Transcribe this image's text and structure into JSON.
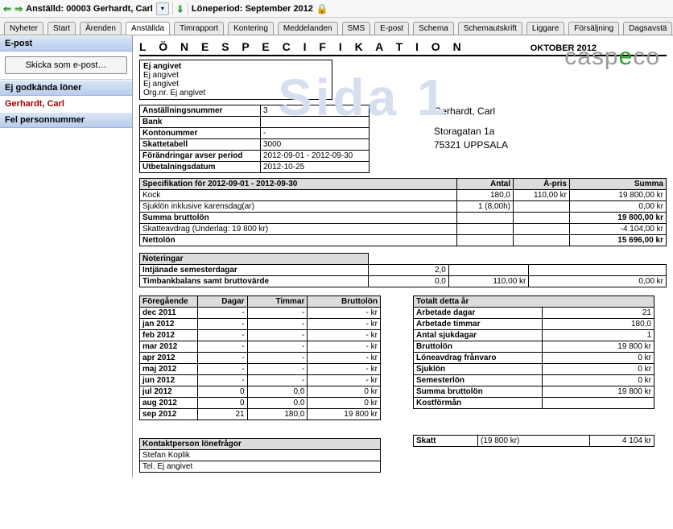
{
  "topbar": {
    "employee_label": "Anställd: 00003 Gerhardt, Carl",
    "period_label": "Löneperiod: September 2012"
  },
  "tabs": [
    "Nyheter",
    "Start",
    "Ärenden",
    "Anställda",
    "Timrapport",
    "Kontering",
    "Meddelanden",
    "SMS",
    "E-post",
    "Schema",
    "Schemautskrift",
    "Liggare",
    "Försäljning",
    "Dagsavstä"
  ],
  "sidebar": {
    "epost_hdr": "E-post",
    "email_btn": "Skicka som e-post…",
    "ej_godk_hdr": "Ej godkända löner",
    "employee_link": "Gerhardt, Carl",
    "fel_pers_hdr": "Fel personnummer"
  },
  "doc": {
    "title": "L Ö N E S P E C I F I K A T I O N",
    "month": "OKTOBER 2012",
    "watermark": "Sida 1",
    "logo": "caspeco",
    "company": {
      "l1": "Ej angivet",
      "l2": "Ej angivet",
      "l3": "Ej angivet",
      "l4": "Org.nr. Ej angivet"
    },
    "emp_info": [
      [
        "Anställningsnummer",
        "3"
      ],
      [
        "Bank",
        ""
      ],
      [
        "Kontonummer",
        "-"
      ],
      [
        "Skattetabell",
        "3000"
      ],
      [
        "Förändringar avser period",
        "2012-09-01 - 2012-09-30"
      ],
      [
        "Utbetalningsdatum",
        "2012-10-25"
      ]
    ],
    "name": "Gerhardt, Carl",
    "addr1": "Storagatan 1a",
    "addr2": "75321 UPPSALA",
    "spec_hdr": "Specifikation för 2012-09-01 - 2012-09-30",
    "spec_cols": [
      "",
      "Antal",
      "À-pris",
      "Summa"
    ],
    "spec_rows": [
      {
        "label": "Kock",
        "antal": "180,0",
        "apris": "110,00 kr",
        "summa": "19 800,00 kr",
        "bold": false
      },
      {
        "label": "Sjuklön inklusive karensdag(ar)",
        "antal": "1 (8,00h)",
        "apris": "",
        "summa": "0,00 kr",
        "bold": false
      },
      {
        "label": "Summa bruttolön",
        "antal": "",
        "apris": "",
        "summa": "19 800,00 kr",
        "bold": true
      },
      {
        "label": "Skatteavdrag (Underlag: 19 800 kr)",
        "antal": "",
        "apris": "",
        "summa": "-4 104,00 kr",
        "bold": false
      },
      {
        "label": "Nettolön",
        "antal": "",
        "apris": "",
        "summa": "15 696,00 kr",
        "bold": true
      }
    ],
    "notes_hdr": "Noteringar",
    "notes_rows": [
      {
        "label": "Intjänade semesterdagar",
        "c2": "2,0",
        "c3": "",
        "c4": ""
      },
      {
        "label": "Timbankbalans samt bruttovärde",
        "c2": "0,0",
        "c3": "110,00 kr",
        "c4": "0,00 kr"
      }
    ],
    "prev_cols": [
      "Föregående",
      "Dagar",
      "Timmar",
      "Bruttolön"
    ],
    "prev_rows": [
      [
        "dec 2011",
        "-",
        "-",
        "- kr"
      ],
      [
        "jan 2012",
        "-",
        "-",
        "- kr"
      ],
      [
        "feb 2012",
        "-",
        "-",
        "- kr"
      ],
      [
        "mar 2012",
        "-",
        "-",
        "- kr"
      ],
      [
        "apr 2012",
        "-",
        "-",
        "- kr"
      ],
      [
        "maj 2012",
        "-",
        "-",
        "- kr"
      ],
      [
        "jun 2012",
        "-",
        "-",
        "- kr"
      ],
      [
        "jul 2012",
        "0",
        "0,0",
        "0 kr"
      ],
      [
        "aug 2012",
        "0",
        "0,0",
        "0 kr"
      ],
      [
        "sep 2012",
        "21",
        "180,0",
        "19 800 kr"
      ]
    ],
    "tot_hdr": "Totalt detta år",
    "tot_rows": [
      [
        "Arbetade dagar",
        "21"
      ],
      [
        "Arbetade timmar",
        "180,0"
      ],
      [
        "Antal sjukdagar",
        "1"
      ],
      [
        "Bruttolön",
        "19 800 kr"
      ],
      [
        "Löneavdrag frånvaro",
        "0 kr"
      ],
      [
        "Sjuklön",
        "0 kr"
      ],
      [
        "Semesterlön",
        "0 kr"
      ],
      [
        "Summa bruttolön",
        "19 800 kr"
      ],
      [
        "Kostförmån",
        ""
      ]
    ],
    "skatt": [
      "Skatt",
      "(19 800 kr)",
      "4 104 kr"
    ],
    "contact_hdr": "Kontaktperson lönefrågor",
    "contact_rows": [
      "Stefan Koplik",
      "Tel. Ej angivet"
    ]
  }
}
